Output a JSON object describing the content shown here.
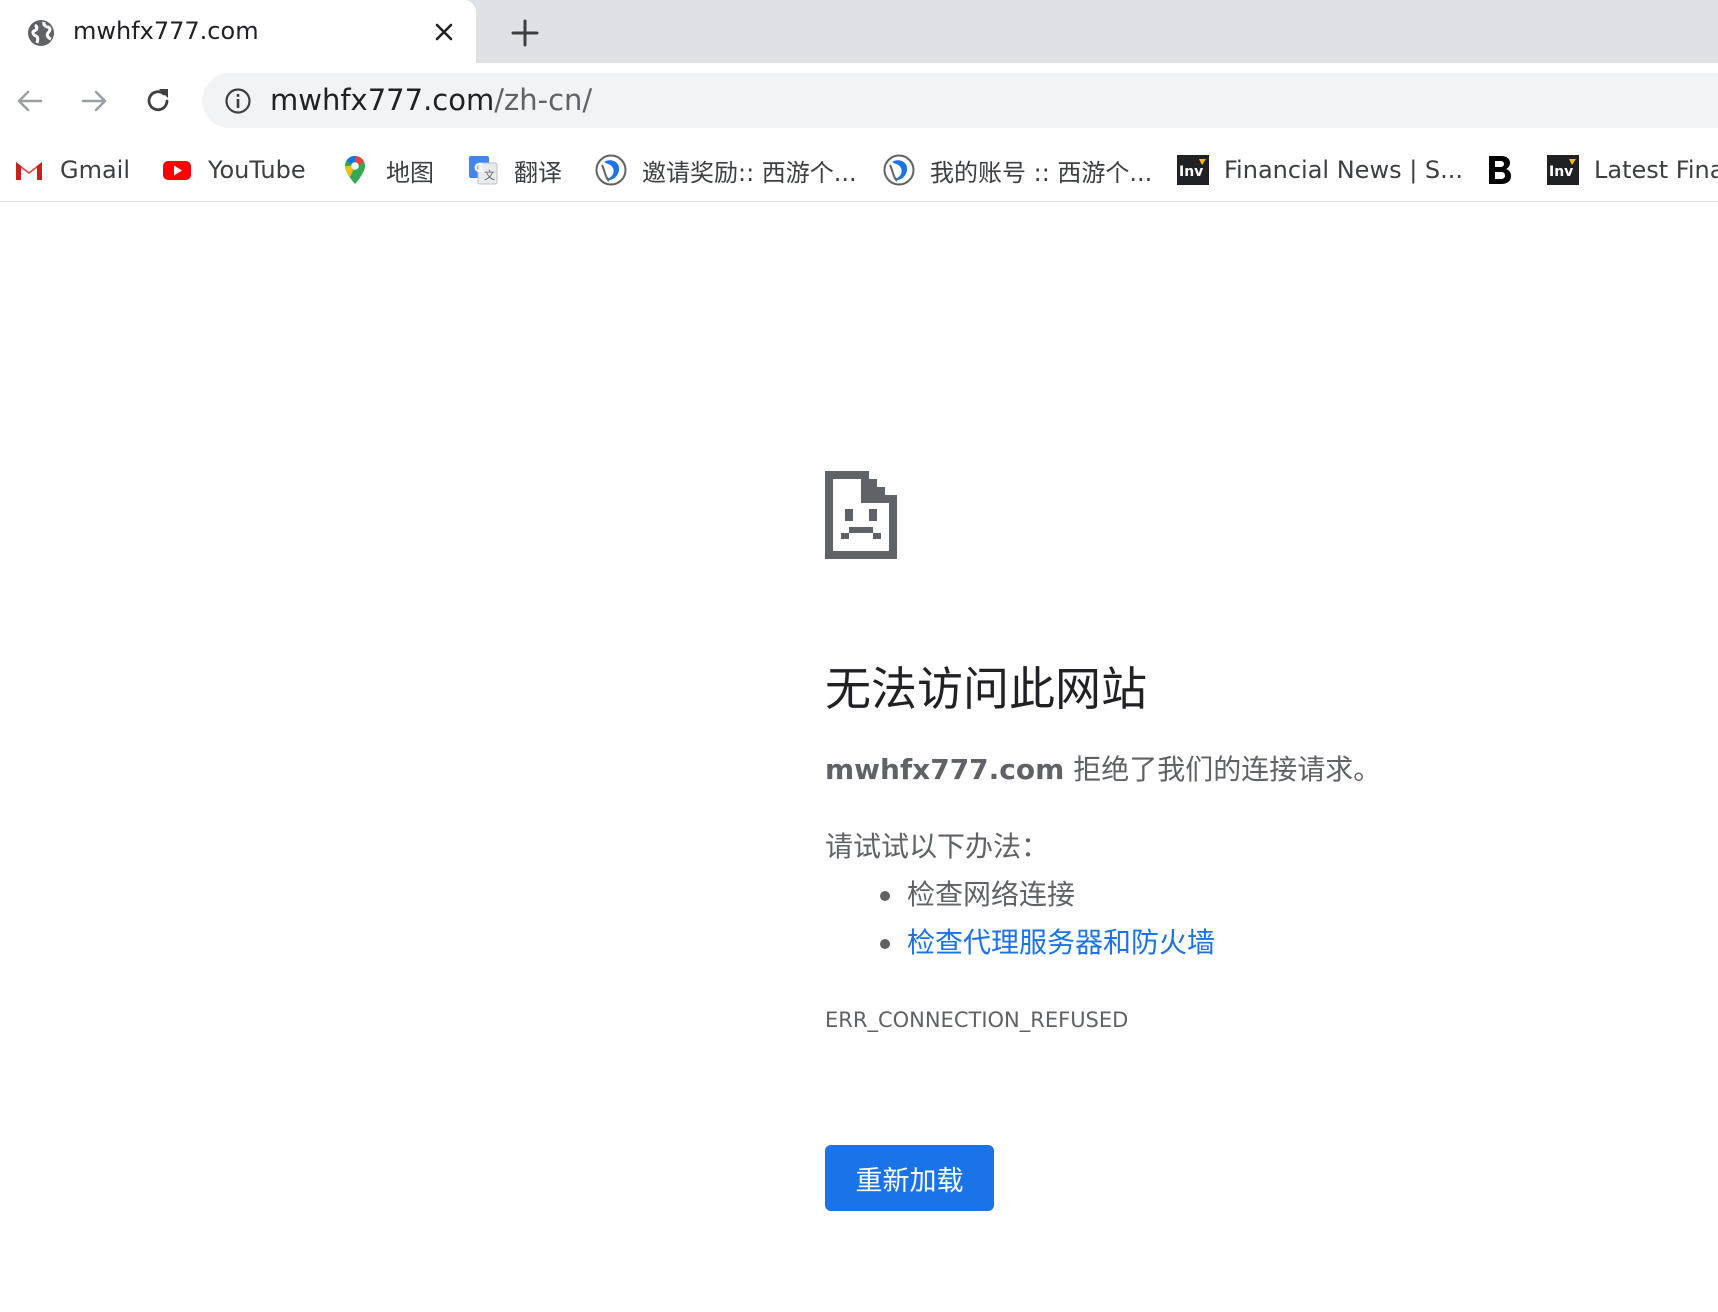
{
  "tab": {
    "title": "mwhfx777.com",
    "favicon": "globe-icon",
    "close": "close-icon",
    "new_tab": "plus-icon"
  },
  "toolbar": {
    "back": "arrow-left-icon",
    "forward": "arrow-right-icon",
    "reload": "reload-icon",
    "url_host": "mwhfx777.com",
    "url_path": "/zh-cn/",
    "info": "info-icon"
  },
  "bookmarks": [
    {
      "label": "Gmail",
      "icon": "gmail-icon"
    },
    {
      "label": "YouTube",
      "icon": "youtube-icon"
    },
    {
      "label": "地图",
      "icon": "maps-pin-icon"
    },
    {
      "label": "翻译",
      "icon": "translate-icon"
    },
    {
      "label": "邀请奖励:: 西游个...",
      "icon": "site-logo-icon"
    },
    {
      "label": "我的账号 :: 西游个...",
      "icon": "site-logo-icon"
    },
    {
      "label": "Financial News | S...",
      "icon": "investing-icon"
    },
    {
      "label": "",
      "icon": "bold-b-icon"
    },
    {
      "label": "Latest Fina",
      "icon": "investing-icon"
    }
  ],
  "error": {
    "icon": "sad-page-icon",
    "title": "无法访问此网站",
    "host": "mwhfx777.com",
    "desc_rest": " 拒绝了我们的连接请求。",
    "try_label": "请试试以下办法：",
    "suggestions": [
      {
        "text": "检查网络连接",
        "link": false
      },
      {
        "text": "检查代理服务器和防火墙",
        "link": true
      }
    ],
    "code": "ERR_CONNECTION_REFUSED",
    "reload_label": "重新加载"
  },
  "colors": {
    "accent": "#1a73e8",
    "tabstrip": "#dee1e6",
    "omnibox": "#f1f3f4",
    "text_secondary": "#5f6368"
  }
}
